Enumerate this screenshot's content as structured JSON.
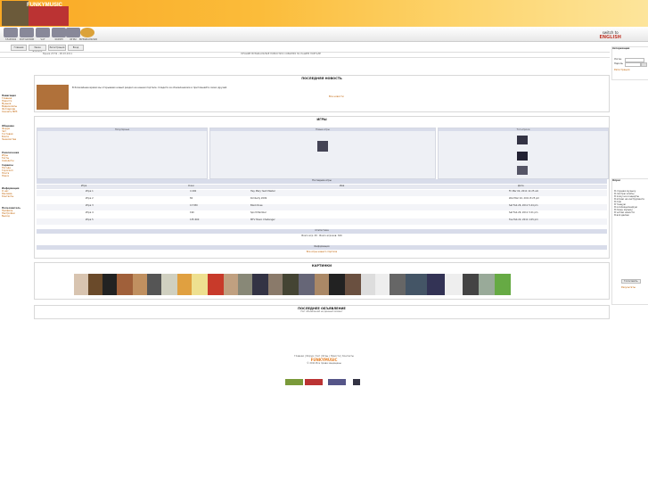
{
  "header": {
    "brand": "FUNKYMUSIC"
  },
  "nav": {
    "items": [
      "ГЛАВНАЯ",
      "ФОТОАРХИВ",
      "ЧАТ",
      "ФОРУМ",
      "ИГРЫ",
      "МУЗЫКАЛЬНАЯ"
    ],
    "language_label": "switch to",
    "language": "ENGLISH"
  },
  "toolbar": {
    "buttons": [
      "Главная",
      "Заказ билетов",
      "Регистрация",
      "Вход"
    ]
  },
  "subbar": {
    "left_text": "Время 23:59 - 08.03.2011",
    "center_text": "ЛУЧШИЕ МУЗЫКАЛЬНЫЕ НОВОСТИ И СОБЫТИЯ НА НАШЕМ ПОРТАЛЕ"
  },
  "sidebar": {
    "sections": [
      {
        "title": "Навигация",
        "items": [
          "Главная",
          "Новости",
          "Музыка",
          "Видеоклипы",
          "Фотоархив",
          "Скачать MP3"
        ]
      },
      {
        "title": "Общение",
        "items": [
          "Форум",
          "Чат",
          "Гостевая",
          "Блоги",
          "Знакомства"
        ]
      },
      {
        "title": "Развлечения",
        "items": [
          "Игры",
          "Тесты",
          "Анекдоты"
        ]
      },
      {
        "title": "Сервисы",
        "items": [
          "Погода",
          "Гороскоп",
          "Почта",
          "Поиск"
        ]
      },
      {
        "title": "Информация",
        "items": [
          "О нас",
          "Реклама",
          "Контакты"
        ]
      },
      {
        "title": "Пользователь",
        "items": [
          "Профиль",
          "Настройки",
          "Выход"
        ]
      }
    ]
  },
  "news": {
    "title": "ПОСЛЕДНЯЯ НОВОСТЬ",
    "body": "В ближайшее время мы открываем новый раздел на нашем портале. Следите за обновлениями и приглашайте своих друзей.",
    "more": "Все новости"
  },
  "games": {
    "title": "ИГРЫ",
    "col_titles": [
      "Популярные",
      "Новые игры",
      "Топ игроки"
    ],
    "table_header": "Последние игры",
    "columns": [
      "Игра",
      "Очки",
      "Имя",
      "Дата"
    ],
    "rows": [
      {
        "game": "Игра 1",
        "score": "4 490",
        "name": "Hey Mary Yeah Master",
        "date": "Fri Mar 04, 2011 11:25 am"
      },
      {
        "game": "Игра 2",
        "score": "82",
        "name": "Kimberly 2009",
        "date": "Wed Mar 02, 2011 8:25 pm"
      },
      {
        "game": "Игра 3",
        "score": "13 830",
        "name": "Black Rose",
        "date": "Sat Feb 26, 2011 5:44 pm"
      },
      {
        "game": "Игра 4",
        "score": "190",
        "name": "Sport Member",
        "date": "Sat Feb 26, 2011 3:21 pm"
      },
      {
        "game": "Игра 5",
        "score": "135 600",
        "name": "MTV Music Challenger",
        "date": "Tue Feb 22, 2011 1:05 pm"
      }
    ],
    "stats_header": "Статистика",
    "stats_text": "Всего игр: 45 · Всего игроков: 320",
    "links_header": "Информация",
    "links_text": "Все игры нашего портала"
  },
  "pictures": {
    "title": "КАРТИНКИ"
  },
  "announce": {
    "title": "ПОСЛЕДНЕЕ ОБЪЯВЛЕНИЕ",
    "body": "Нет объявлений на данный момент"
  },
  "rightcol": {
    "login_title": "Авторизация",
    "login_label": "Логин",
    "pass_label": "Пароль",
    "register": "Регистрация",
    "poll_title": "Опрос",
    "poll_options": [
      "Я слушаю музыку",
      "Я смотрю клипы",
      "Я хожу на концерты",
      "Я играю на инструменте",
      "Я пою",
      "Я танцую",
      "Я коллекционирую",
      "Я пишу музыку",
      "Я читаю новости",
      "Я всё делаю"
    ],
    "vote": "Голосовать",
    "results": "Результаты"
  },
  "footer": {
    "links": "Главная | Форум | Чат | Игры | Новости | Контакты",
    "brand": "FUNKYMUSIC",
    "copy": "© 2011 Все права защищены"
  },
  "colors": {
    "header": "#f9a824",
    "accent": "#c06000",
    "link": "#c0392b"
  }
}
